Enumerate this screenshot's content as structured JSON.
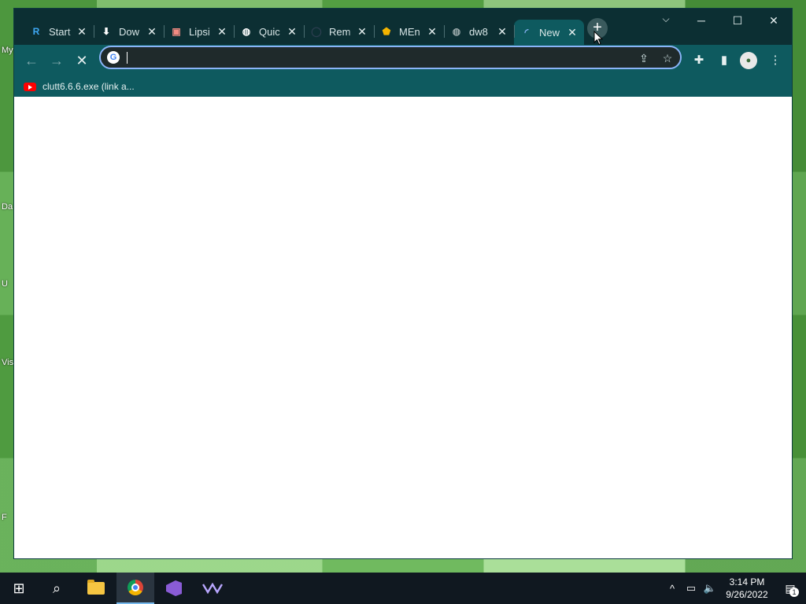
{
  "desktop": {
    "icon_labels": [
      "My",
      "Da",
      "U",
      "Vis",
      "F"
    ]
  },
  "browser": {
    "tabs": [
      {
        "title": "Start",
        "icon": "r-icon",
        "glyph": "R",
        "color": "#3fa9f5"
      },
      {
        "title": "Dow",
        "icon": "download-icon",
        "glyph": "⬇",
        "color": "#ffffff"
      },
      {
        "title": "Lipsi",
        "icon": "image-icon",
        "glyph": "▣",
        "color": "#f28b82"
      },
      {
        "title": "Quic",
        "icon": "globe-icon",
        "glyph": "◍",
        "color": "#ffffff"
      },
      {
        "title": "Rem",
        "icon": "circle-icon",
        "glyph": "◯",
        "color": "#2c3e50"
      },
      {
        "title": "MEn",
        "icon": "pentagon-icon",
        "glyph": "⬟",
        "color": "#f4b400"
      },
      {
        "title": "dw8",
        "icon": "globe-icon",
        "glyph": "◍",
        "color": "#9aa9aa"
      },
      {
        "title": "New",
        "icon": "loading-spinner-icon",
        "glyph": "◜",
        "color": "#8ab4f8",
        "active": true
      }
    ],
    "tab_close_glyph": "✕",
    "new_tab_glyph": "+",
    "tab_list_glyph": "⌵",
    "window_controls": {
      "minimize": "─",
      "maximize": "☐",
      "close": "✕"
    },
    "nav": {
      "back": "←",
      "forward": "→",
      "stop": "✕"
    },
    "omnibox": {
      "value": "",
      "placeholder": "",
      "google_glyph": "G"
    },
    "omnibox_actions": {
      "share": "⇪",
      "bookmark": "☆"
    },
    "toolbar_actions": {
      "extensions": "✚",
      "side_panel": "▮",
      "menu": "⋮",
      "profile": "●"
    },
    "bookmarks": [
      {
        "label": "clutt6.6.6.exe (link a...",
        "icon": "youtube-icon"
      }
    ]
  },
  "taskbar": {
    "start": "⊞",
    "search": "⌕",
    "tray": {
      "chevron": "^",
      "network": "▭",
      "volume": "🔈"
    },
    "clock": {
      "time": "3:14 PM",
      "date": "9/26/2022"
    },
    "notifications": {
      "glyph": "▤",
      "count": "1"
    }
  }
}
